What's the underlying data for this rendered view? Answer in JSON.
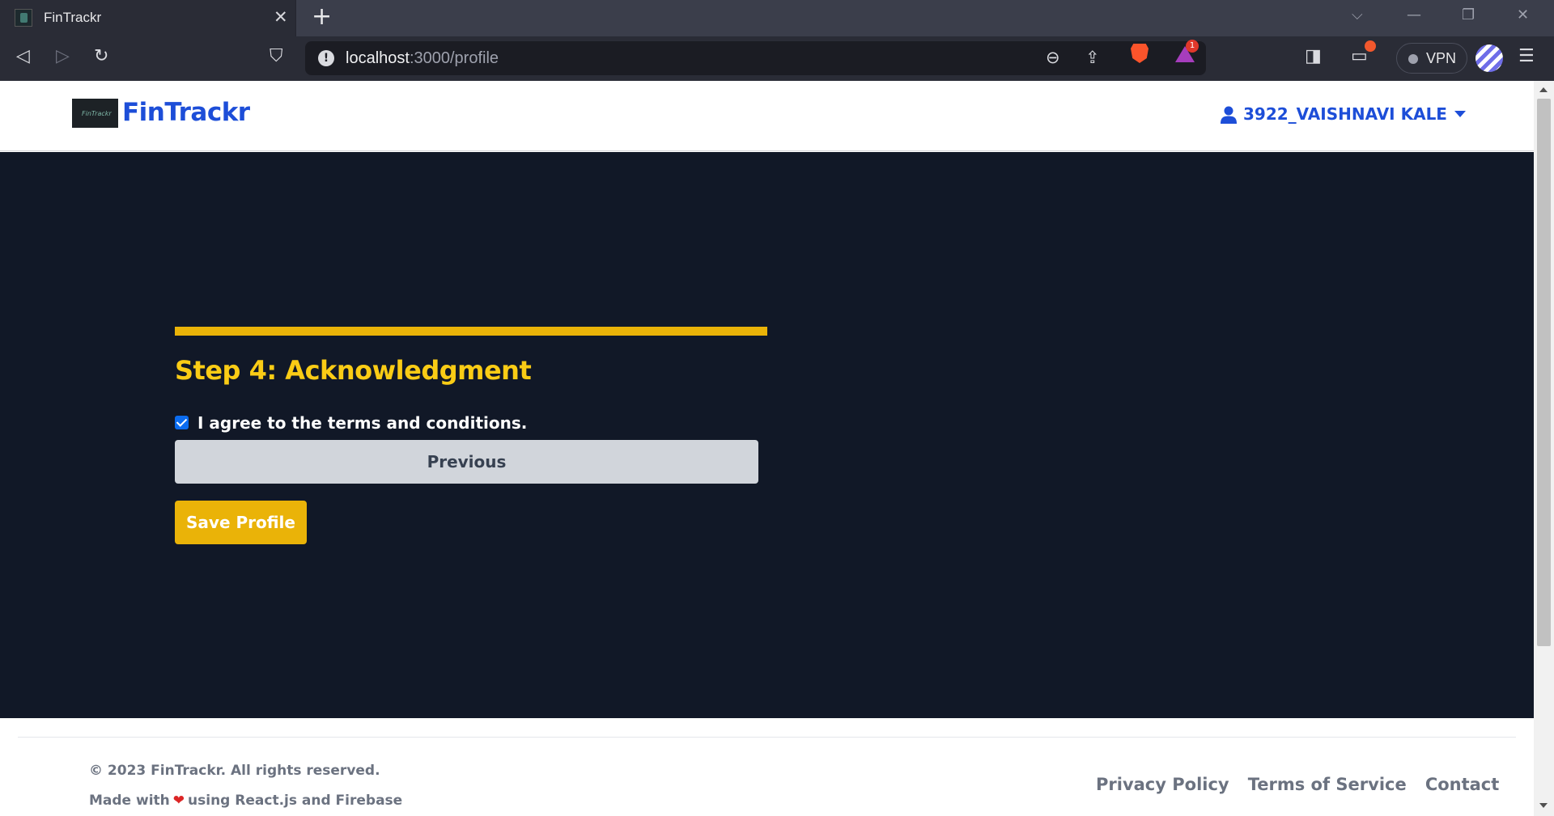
{
  "browser": {
    "tab_title": "FinTrackr",
    "tab_close": "✕",
    "new_tab": "+",
    "url_host": "localhost",
    "url_path": ":3000/profile",
    "rewards_count": "1",
    "vpn_label": "VPN",
    "icons": [
      "back-icon",
      "forward-icon",
      "reload-icon",
      "bookmark-icon",
      "site-info-icon",
      "zoom-icon",
      "share-icon",
      "brave-shields-icon",
      "brave-rewards-icon",
      "sidebar-icon",
      "wallet-icon",
      "vpn-icon",
      "profile-icon",
      "menu-icon"
    ]
  },
  "navbar": {
    "brand_logo_text": "FinTrackr",
    "brand_name": "FinTrackr",
    "user_name": "3922_VAISHNAVI KALE",
    "brand_color": "#1d4ed8"
  },
  "form": {
    "progress": 1.0,
    "step_title": "Step 4: Acknowledgment",
    "agree_checked": true,
    "agree_label": "I agree to the terms and conditions.",
    "previous_label": "Previous",
    "save_label": "Save Profile",
    "accent_color": "#eab308",
    "background_color": "#111827"
  },
  "footer": {
    "copyright": "© 2023 FinTrackr. All rights reserved.",
    "made_with_prefix": "Made with",
    "made_with_suffix": "using React.js and Firebase",
    "links": [
      "Privacy Policy",
      "Terms of Service",
      "Contact"
    ]
  }
}
